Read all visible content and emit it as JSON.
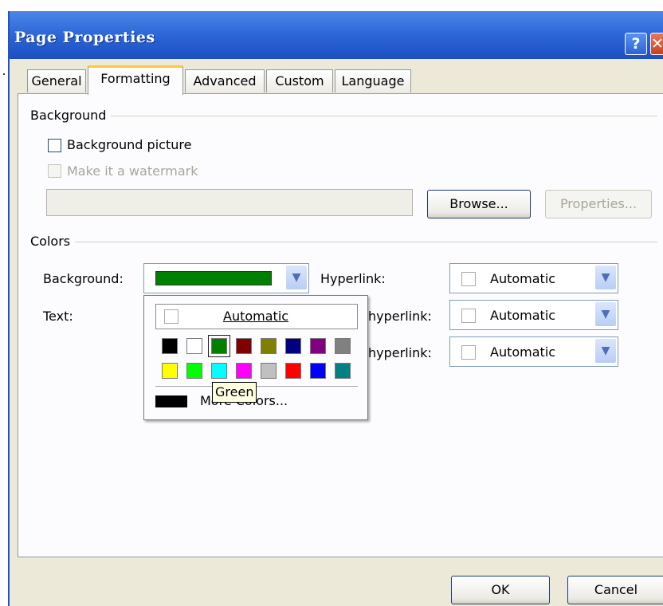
{
  "window": {
    "title": "Page Properties",
    "help_glyph": "?",
    "close_glyph": "✕"
  },
  "tabs": [
    "General",
    "Formatting",
    "Advanced",
    "Custom",
    "Language"
  ],
  "background_group": {
    "label": "Background",
    "background_picture_label": "Background picture",
    "watermark_label": "Make it a watermark",
    "browse_label": "Browse...",
    "properties_label": "Properties..."
  },
  "colors_group": {
    "label": "Colors",
    "background_label": "Background:",
    "background_value": "#008000",
    "text_label": "Text:",
    "hyperlink_label": "Hyperlink:",
    "visited_hyperlink_label": "hyperlink:",
    "active_hyperlink_label": "hyperlink:",
    "automatic": "Automatic"
  },
  "palette": {
    "automatic_label": "Automatic",
    "row1": [
      "#000000",
      "#ffffff",
      "#008000",
      "#800000",
      "#808000",
      "#000080",
      "#800080",
      "#808080"
    ],
    "row2": [
      "#ffff00",
      "#00ff00",
      "#00ffff",
      "#ff00ff",
      "#c0c0c0",
      "#ff0000",
      "#0000ff",
      "#008080"
    ],
    "selected_color": "#008000",
    "more_colors_label": "More Colors...",
    "tooltip": "Green"
  },
  "footer": {
    "ok_label": "OK",
    "cancel_label": "Cancel"
  }
}
